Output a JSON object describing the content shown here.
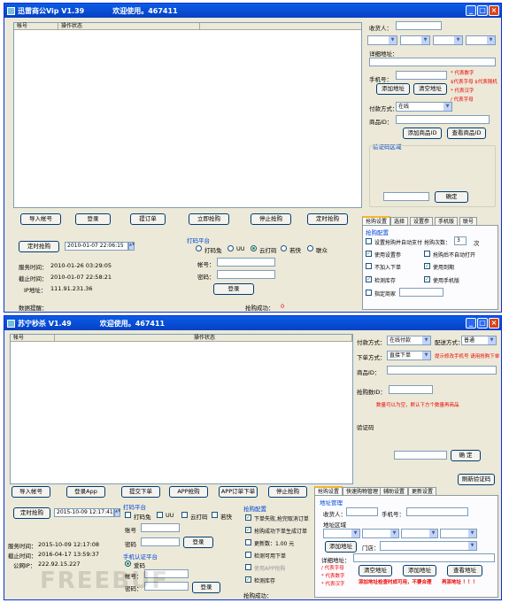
{
  "w1": {
    "title": "迅雷商公Vip V1.39",
    "subtitle": "欢迎使用。467411",
    "col_account": "帐号",
    "col_status": "操作状态",
    "buyer_label": "收货人：",
    "address_label": "详细地址：",
    "phone_label": "手机号：",
    "btn_add_addr": "添加地址",
    "btn_clear_addr": "清空地址",
    "notes": [
      "* 代表数字",
      "$代表字母 $代表随机",
      "* 代表汉字",
      "/ 代表字母"
    ],
    "pay_label": "付款方式：",
    "pay_value": "在线",
    "product_label": "商品ID：",
    "btn_add_product": "添加商品ID",
    "btn_view_product": "查看商品ID",
    "captcha_label": "验证码区域",
    "btn_confirm": "确定",
    "btn_import": "导入帐号",
    "btn_login": "登录",
    "btn_order": "提订单",
    "btn_rush": "立即抢购",
    "btn_stop": "停止抢购",
    "btn_schedule": "定时抢购",
    "btn_timer": "定时抢购",
    "timer_value": "2010-01-07 22:06:15",
    "server_time_label": "服务时间：",
    "server_time": "2010-01-26 03:29:05",
    "end_time_label": "截止时间：",
    "end_time": "2010-01-07 22:58:21",
    "ip_label": "IP地址：",
    "ip": "111.91.231.36",
    "platform_title": "打码平台",
    "platform_opts": [
      "打码兔",
      "UU",
      "云打码",
      "若快",
      "联众"
    ],
    "account_label": "帐号：",
    "password_label": "密码：",
    "btn_login2": "登录",
    "status_label": "数据提醒：",
    "success_label": "抢购成功：",
    "success_count": "0",
    "tabs": [
      "抢购设置",
      "选择",
      "设置参",
      "手机版",
      "联号"
    ],
    "settings_title": "抢购配置",
    "cb_items": [
      "设置抢购并自动支付",
      "使用设置参",
      "不加入下单",
      "检测库存",
      "指定商家"
    ],
    "retry_label": "抢购次数：",
    "retry_value": "3",
    "retry_unit": "次",
    "cb_right": [
      "抢购后不自动打开",
      "使用到期",
      "使用手机版"
    ]
  },
  "w2": {
    "title": "苏宁秒杀 V1.49",
    "subtitle": "欢迎使用。467411",
    "col_account": "帐号",
    "col_status": "操作状态",
    "pay_label": "付款方式：",
    "pay_value": "在线付款",
    "ship_label": "配送方式：",
    "ship_value": "普通",
    "order_label": "下单方式：",
    "order_value": "直接下单",
    "order_note": "提示修改手机号 请用抢购下单",
    "product_label": "商品ID：",
    "qty_label": "抢购数ID：",
    "qty_note": "数量可以为空，默认下方个数量再商品",
    "captcha_label": "验证码",
    "btn_confirm": "确 定",
    "btn_refresh": "刷新验证码",
    "btn_import": "导入帐号",
    "btn_login": "登录App",
    "btn_order": "提交下单",
    "btn_app_rush": "APP抢购",
    "btn_app_order": "APP订单下单",
    "btn_stop": "停止抢购",
    "btn_timer": "定时抢购",
    "timer_value": "2015-10-09 12:17:41",
    "platform_title": "打码平台",
    "platform_opts": [
      "打码兔",
      "UU",
      "云打码",
      "若快"
    ],
    "account_label": "账号",
    "password_label": "密码",
    "btn_login2": "登录",
    "server_time_label": "服务时间：",
    "server_time": "2015-10-09 12:17:08",
    "end_time_label": "截止时间：",
    "end_time": "2016-04-17 13:59:37",
    "ip_label": "公网IP：",
    "ip": "222.92.15.227",
    "sms_title": "手机认证平台",
    "sms_opt": "爱码",
    "sms_account_label": "帐号：",
    "sms_password_label": "密码：",
    "btn_sms_login": "登录",
    "settings_title": "抢购配置",
    "cb_items": [
      "下单失败,抢完取消订单",
      "抢购成功下单生成订单",
      "更新数：1.00 元",
      "检测可用下单",
      "使用APP抢购",
      "检测库存"
    ],
    "success_label": "抢购成功：",
    "tabs": [
      "抢购设置",
      "快速购物管理",
      "辅助设置",
      "更新设置"
    ],
    "addr_title": "地址管理",
    "addr_buyer": "收货人：",
    "addr_phone": "手机号：",
    "addr_region": "地址区域",
    "btn_add_addr": "添加地址",
    "door_label": "门店：",
    "detail_label": "详细地址：",
    "notes": [
      "/ 代表字母",
      "* 代表数字",
      "* 代表汉字"
    ],
    "btn_clear": "清空地址",
    "btn_batch": "添加地址",
    "btn_view": "查看地址",
    "warning": "添加地址检查时成可用，不要合理",
    "warning2": "再添地址 ！！！",
    "watermark": "FREEBUF"
  }
}
